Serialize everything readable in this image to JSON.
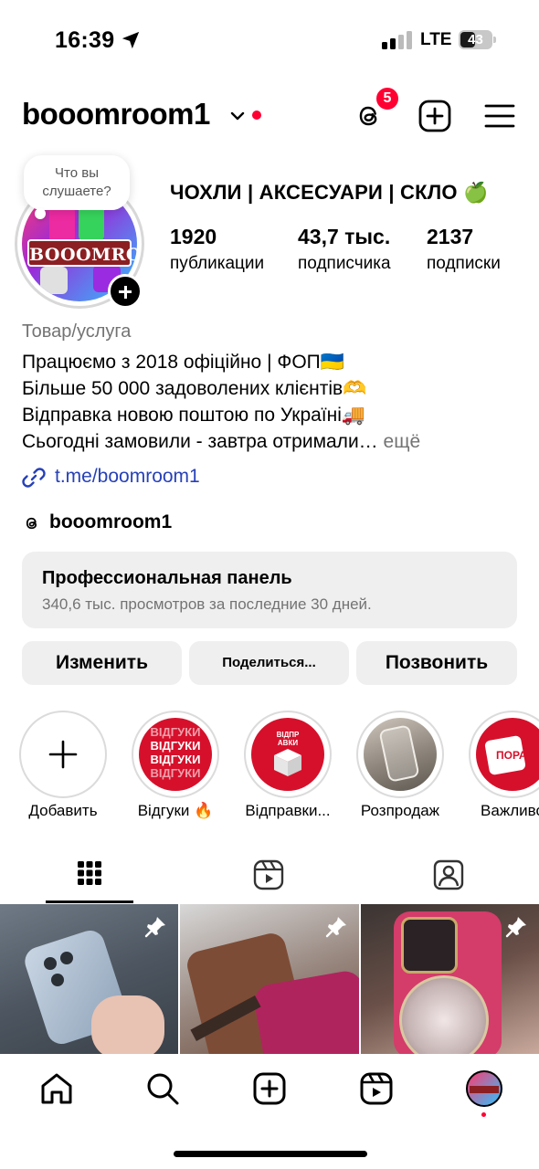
{
  "status_bar": {
    "time": "16:39",
    "network": "LTE",
    "battery": "43"
  },
  "header": {
    "username": "booomroom1",
    "notification_count": "5",
    "icons": [
      "chevron-down-icon",
      "threads-icon",
      "create-icon",
      "menu-icon"
    ]
  },
  "profile": {
    "note_placeholder": "Что вы слушаете?",
    "avatar_text": "BOOOMROOM",
    "display_name": "ЧОХЛИ | АКСЕСУАРИ | СКЛО 🍏",
    "stats": [
      {
        "value": "1920",
        "label": "публикации"
      },
      {
        "value": "43,7 тыс.",
        "label": "подписчика"
      },
      {
        "value": "2137",
        "label": "подписки"
      }
    ],
    "category": "Товар/услуга",
    "bio_lines": [
      "Працюємо з 2018 офіційно | ФОП🇺🇦",
      "Більше 50 000 задоволених клієнтів🫶",
      "Відправка новою поштою по Україні🚚",
      "Сьогодні замовили - завтра отримали…"
    ],
    "more_label": "ещё",
    "link": "t.me/boomroom1",
    "threads_handle": "booomroom1"
  },
  "professional_panel": {
    "title": "Профессиональная панель",
    "subtitle": "340,6 тыс. просмотров за последние 30 дней."
  },
  "actions": {
    "edit": "Изменить",
    "share": "Поделиться...",
    "call": "Позвонить"
  },
  "highlights": [
    {
      "label": "Добавить",
      "inner_text": ""
    },
    {
      "label": "Відгуки 🔥",
      "inner_text": "ВІДГУКИ"
    },
    {
      "label": "Відправки...",
      "inner_text": "ВІДПР АВКИ"
    },
    {
      "label": "Розпродаж",
      "inner_text": ""
    },
    {
      "label": "Важливо",
      "inner_text": "ПОРАДИ"
    }
  ],
  "tabs": [
    "grid-icon",
    "reels-icon",
    "tagged-icon"
  ],
  "grid_posts": [
    {
      "pinned": true
    },
    {
      "pinned": true
    },
    {
      "pinned": true
    }
  ],
  "bottom_nav": [
    "home-icon",
    "search-icon",
    "create-icon",
    "reels-icon",
    "profile-avatar"
  ],
  "colors": {
    "accent_red": "#ff0033",
    "link_blue": "#2741b8",
    "muted_gray": "#737373",
    "panel_bg": "#efefef"
  }
}
